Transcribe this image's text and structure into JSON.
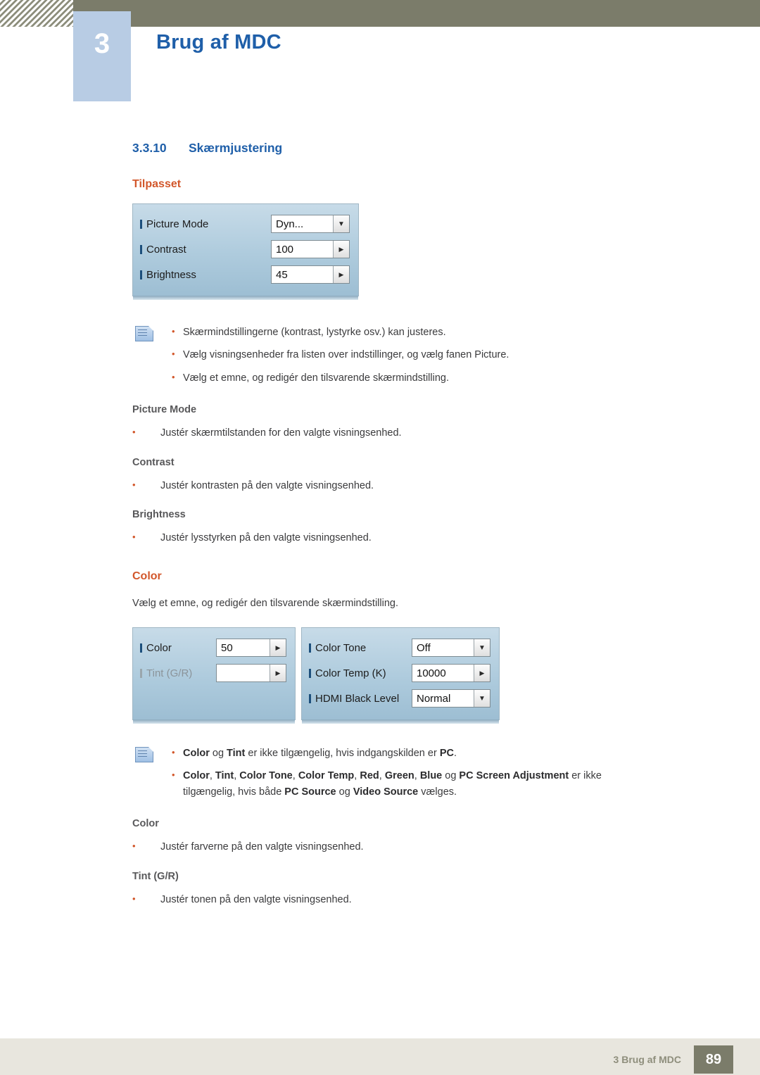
{
  "header": {
    "chapter_number": "3",
    "chapter_title": "Brug af MDC"
  },
  "section": {
    "number": "3.3.10",
    "title": "Skærmjustering"
  },
  "tilpasset": {
    "heading": "Tilpasset",
    "widget": {
      "rows": [
        {
          "label": "Picture Mode",
          "value": "Dyn...",
          "control": "dropdown"
        },
        {
          "label": "Contrast",
          "value": "100",
          "control": "spinner"
        },
        {
          "label": "Brightness",
          "value": "45",
          "control": "spinner"
        }
      ]
    },
    "notes": [
      "Skærmindstillingerne (kontrast, lystyrke osv.) kan justeres.",
      "Vælg visningsenheder fra listen over indstillinger, og vælg fanen Picture.",
      "Vælg et emne, og redigér den tilsvarende skærmindstilling."
    ],
    "notes_bold": [
      "",
      "Picture",
      ""
    ],
    "items": [
      {
        "title": "Picture Mode",
        "text": "Justér skærmtilstanden for den valgte visningsenhed."
      },
      {
        "title": "Contrast",
        "text": "Justér kontrasten på den valgte visningsenhed."
      },
      {
        "title": "Brightness",
        "text": "Justér lysstyrken på den valgte visningsenhed."
      }
    ]
  },
  "color": {
    "heading": "Color",
    "intro": "Vælg et emne, og redigér den tilsvarende skærmindstilling.",
    "widget_left": {
      "rows": [
        {
          "label": "Color",
          "value": "50",
          "control": "spinner",
          "disabled": false
        },
        {
          "label": "Tint (G/R)",
          "value": "",
          "control": "spinner",
          "disabled": true
        }
      ]
    },
    "widget_right": {
      "rows": [
        {
          "label": "Color Tone",
          "value": "Off",
          "control": "dropdown"
        },
        {
          "label": "Color Temp (K)",
          "value": "10000",
          "control": "spinner"
        },
        {
          "label": "HDMI Black Level",
          "value": "Normal",
          "control": "dropdown"
        }
      ]
    },
    "note1": {
      "pre": "",
      "b1": "Color",
      "mid1": " og ",
      "b2": "Tint",
      "mid2": " er ikke tilgængelig, hvis indgangskilden er ",
      "b3": "PC",
      "post": "."
    },
    "note2": {
      "b1": "Color",
      "s1": ", ",
      "b2": "Tint",
      "s2": ", ",
      "b3": "Color Tone",
      "s3": ", ",
      "b4": "Color Temp",
      "s4": ", ",
      "b5": "Red",
      "s5": ", ",
      "b6": "Green",
      "s6": ", ",
      "b7": "Blue",
      "s7": " og ",
      "b8": "PC Screen Adjustment",
      "s8": " er ikke",
      "line2_pre": "tilgængelig, hvis både ",
      "line2_b1": "PC Source",
      "line2_mid": " og ",
      "line2_b2": "Video Source",
      "line2_post": " vælges."
    },
    "items": [
      {
        "title": "Color",
        "text": "Justér farverne på den valgte visningsenhed."
      },
      {
        "title": "Tint (G/R)",
        "text": "Justér tonen på den valgte visningsenhed."
      }
    ]
  },
  "footer": {
    "text": "3 Brug af MDC",
    "page": "89"
  }
}
